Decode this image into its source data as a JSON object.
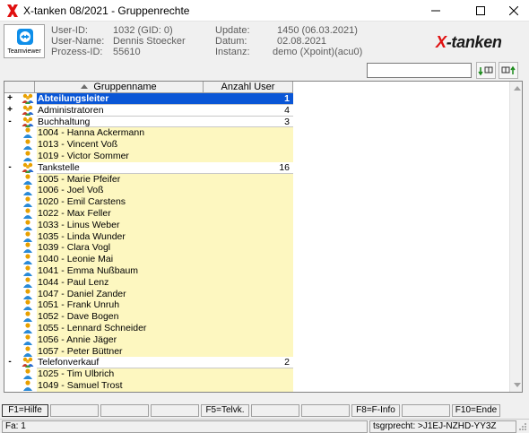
{
  "window": {
    "title": "X-tanken 08/2021 - Gruppenrechte"
  },
  "header": {
    "teamviewer_label": "Teamviewer",
    "left_labels": [
      "User-ID:",
      "User-Name:",
      "Prozess-ID:"
    ],
    "left_values": [
      "1032 (GID: 0)",
      "Dennis Stoecker",
      "55610"
    ],
    "right_labels": [
      "Update:",
      "Datum:",
      "Instanz:"
    ],
    "right_values": [
      "1450 (06.03.2021)",
      "02.08.2021",
      "demo (Xpoint)(acu0)"
    ],
    "brand_x": "X",
    "brand_rest": "-tanken"
  },
  "search": {
    "value": ""
  },
  "grid": {
    "columns": [
      "",
      "Gruppenname",
      "Anzahl User"
    ],
    "rows": [
      {
        "kind": "group",
        "expander": "+",
        "name": "Abteilungsleiter",
        "count": "1",
        "selected": true
      },
      {
        "kind": "group",
        "expander": "+",
        "name": "Administratoren",
        "count": "4"
      },
      {
        "kind": "group",
        "expander": "-",
        "name": "Buchhaltung",
        "count": "3"
      },
      {
        "kind": "user",
        "expander": "",
        "name": "1004 - Hanna Ackermann",
        "count": ""
      },
      {
        "kind": "user",
        "expander": "",
        "name": "1013 - Vincent Voß",
        "count": ""
      },
      {
        "kind": "user",
        "expander": "",
        "name": "1019 - Victor Sommer",
        "count": ""
      },
      {
        "kind": "group",
        "expander": "-",
        "name": "Tankstelle",
        "count": "16"
      },
      {
        "kind": "user",
        "expander": "",
        "name": "1005 - Marie Pfeifer",
        "count": ""
      },
      {
        "kind": "user",
        "expander": "",
        "name": "1006 - Joel Voß",
        "count": ""
      },
      {
        "kind": "user",
        "expander": "",
        "name": "1020 - Emil Carstens",
        "count": ""
      },
      {
        "kind": "user",
        "expander": "",
        "name": "1022 - Max Feller",
        "count": ""
      },
      {
        "kind": "user",
        "expander": "",
        "name": "1033 - Linus Weber",
        "count": ""
      },
      {
        "kind": "user",
        "expander": "",
        "name": "1035 - Linda Wunder",
        "count": ""
      },
      {
        "kind": "user",
        "expander": "",
        "name": "1039 - Clara Vogl",
        "count": ""
      },
      {
        "kind": "user",
        "expander": "",
        "name": "1040 - Leonie Mai",
        "count": ""
      },
      {
        "kind": "user",
        "expander": "",
        "name": "1041 - Emma Nußbaum",
        "count": ""
      },
      {
        "kind": "user",
        "expander": "",
        "name": "1044 - Paul Lenz",
        "count": ""
      },
      {
        "kind": "user",
        "expander": "",
        "name": "1047 - Daniel Zander",
        "count": ""
      },
      {
        "kind": "user",
        "expander": "",
        "name": "1051 - Frank Unruh",
        "count": ""
      },
      {
        "kind": "user",
        "expander": "",
        "name": "1052 - Dave Bogen",
        "count": ""
      },
      {
        "kind": "user",
        "expander": "",
        "name": "1055 - Lennard Schneider",
        "count": ""
      },
      {
        "kind": "user",
        "expander": "",
        "name": "1056 - Annie Jäger",
        "count": ""
      },
      {
        "kind": "user",
        "expander": "",
        "name": "1057 - Peter Büttner",
        "count": ""
      },
      {
        "kind": "group",
        "expander": "-",
        "name": "Telefonverkauf",
        "count": "2"
      },
      {
        "kind": "user",
        "expander": "",
        "name": "1025 - Tim Ulbrich",
        "count": ""
      },
      {
        "kind": "user",
        "expander": "",
        "name": "1049 - Samuel Trost",
        "count": ""
      }
    ]
  },
  "function_keys": [
    "F1=Hilfe",
    "",
    "",
    "",
    "F5=Telvk.",
    "",
    "",
    "F8=F-Info",
    "",
    "F10=Ende"
  ],
  "status": {
    "left": "Fa: 1",
    "right": "tsgrprecht: >J1EJ-NZHD-YY3Z"
  },
  "colors": {
    "selection": "#0a56d6",
    "user_row": "#fdf7c0",
    "brand_red": "#e01010"
  },
  "icons": {
    "group": "group-people-icon",
    "user": "user-person-icon"
  }
}
